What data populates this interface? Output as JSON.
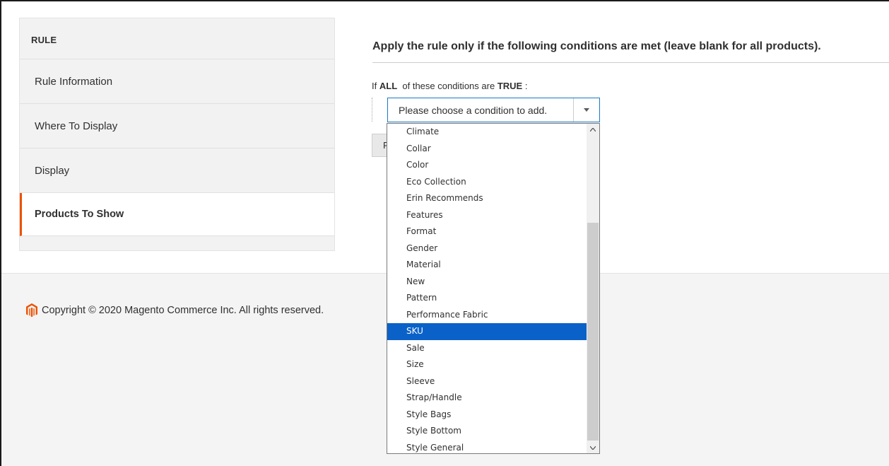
{
  "sidebar": {
    "title": "RULE",
    "items": [
      {
        "label": "Rule Information"
      },
      {
        "label": "Where To Display"
      },
      {
        "label": "Display"
      },
      {
        "label": "Products To Show",
        "active": true
      }
    ]
  },
  "conditions": {
    "heading": "Apply the rule only if the following conditions are met (leave blank for all products).",
    "line_prefix": "If",
    "aggregator": "ALL",
    "line_middle": "of these conditions are",
    "value": "TRUE",
    "line_suffix": ":",
    "select": {
      "value": "Please choose a condition to add.",
      "arrow_icon": "triangle-down-icon"
    },
    "hidden_button_label": "F",
    "options": [
      "Climate",
      "Collar",
      "Color",
      "Eco Collection",
      "Erin Recommends",
      "Features",
      "Format",
      "Gender",
      "Material",
      "New",
      "Pattern",
      "Performance Fabric",
      "SKU",
      "Sale",
      "Size",
      "Sleeve",
      "Strap/Handle",
      "Style Bags",
      "Style Bottom",
      "Style General"
    ],
    "selected_option": "SKU"
  },
  "footer": {
    "copyright": "Copyright © 2020 Magento Commerce Inc. All rights reserved.",
    "logo_icon": "magento-logo-icon"
  },
  "colors": {
    "accent": "#eb5202",
    "selection": "#0a62c9",
    "select_border": "#1979c3",
    "footer_bg": "#f4f4f4",
    "sidebar_bg": "#f2f2f2"
  }
}
